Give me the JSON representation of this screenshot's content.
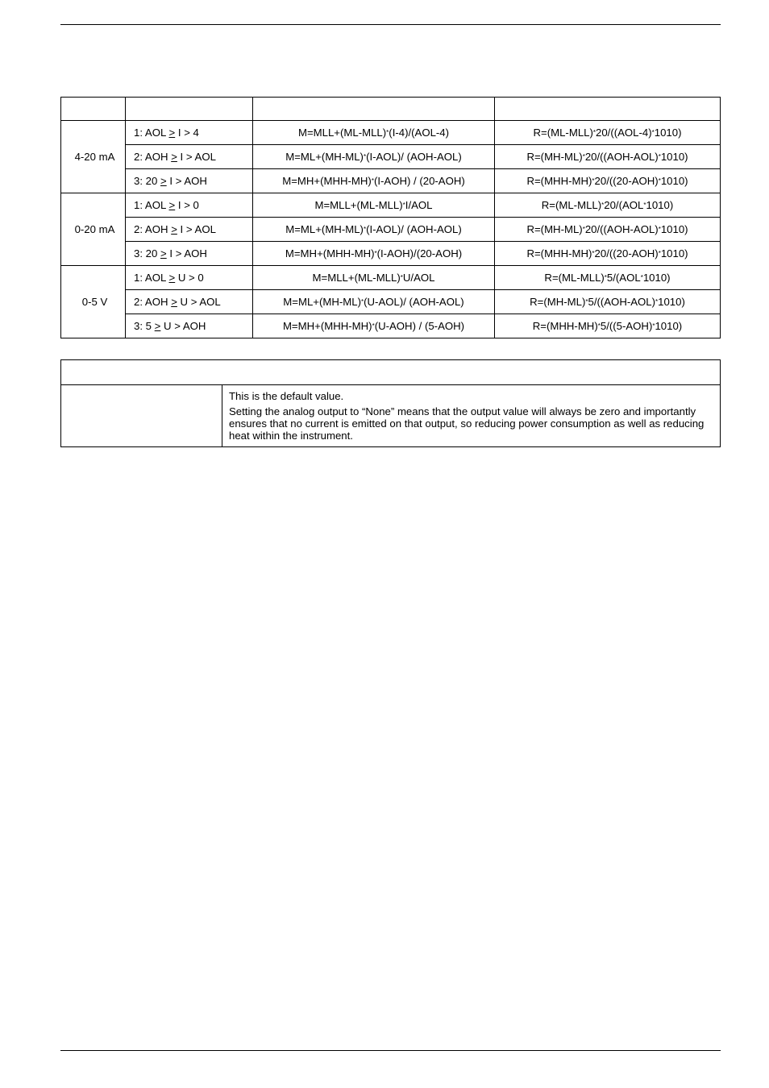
{
  "table1": {
    "groups": [
      {
        "range": "4-20 mA",
        "rows": [
          {
            "cond": "1: AOL > I > 4",
            "m": "M=MLL+(ML-MLL)*(I-4)/(AOL-4)",
            "r": "R=(ML-MLL)*20/((AOL-4)*1010)"
          },
          {
            "cond": "2: AOH > I > AOL",
            "m": "M=ML+(MH-ML)*(I-AOL)/ (AOH-AOL)",
            "r": "R=(MH-ML)*20/((AOH-AOL)*1010)"
          },
          {
            "cond": "3: 20 > I > AOH",
            "m": "M=MH+(MHH-MH)*(I-AOH) / (20-AOH)",
            "r": "R=(MHH-MH)*20/((20-AOH)*1010)"
          }
        ]
      },
      {
        "range": "0-20 mA",
        "rows": [
          {
            "cond": "1: AOL > I > 0",
            "m": "M=MLL+(ML-MLL)*I/AOL",
            "r": "R=(ML-MLL)*20/(AOL*1010)"
          },
          {
            "cond": "2: AOH > I > AOL",
            "m": "M=ML+(MH-ML)*(I-AOL)/ (AOH-AOL)",
            "r": "R=(MH-ML)*20/((AOH-AOL)*1010)"
          },
          {
            "cond": "3: 20 > I > AOH",
            "m": "M=MH+(MHH-MH)*(I-AOH)/(20-AOH)",
            "r": "R=(MHH-MH)*20/((20-AOH)*1010)"
          }
        ]
      },
      {
        "range": "0-5 V",
        "rows": [
          {
            "cond": "1: AOL > U > 0",
            "m": "M=MLL+(ML-MLL)*U/AOL",
            "r": "R=(ML-MLL)*5/(AOL*1010)"
          },
          {
            "cond": "2: AOH > U > AOL",
            "m": "M=ML+(MH-ML)*(U-AOL)/ (AOH-AOL)",
            "r": "R=(MH-ML)*5/((AOH-AOL)*1010)"
          },
          {
            "cond": "3: 5 > U > AOH",
            "m": "M=MH+(MHH-MH)*(U-AOH) / (5-AOH)",
            "r": "R=(MHH-MH)*5/((5-AOH)*1010)"
          }
        ]
      }
    ]
  },
  "table2": {
    "row_text": "This is the default value.\nSetting the analog output to “None” means that the output value will always be zero and importantly ensures that no current is emitted on that output, so reducing power consumption as well as reducing heat within the instrument."
  }
}
